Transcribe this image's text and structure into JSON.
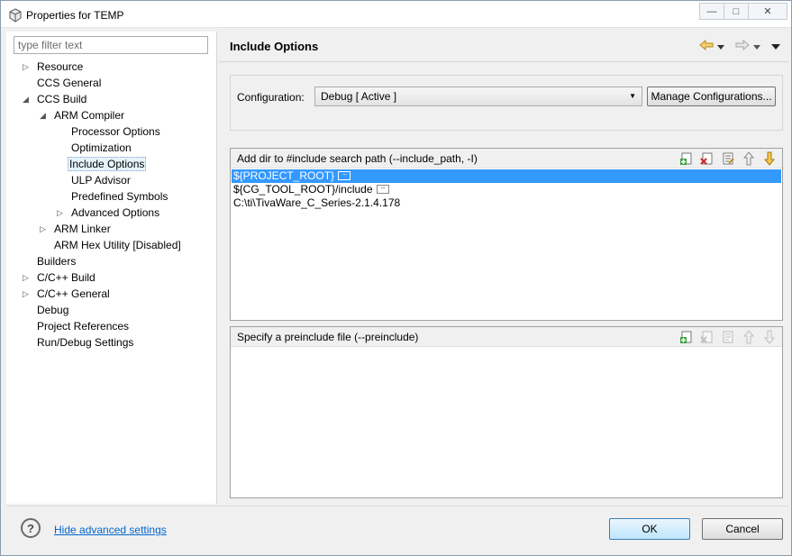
{
  "window": {
    "title": "Properties for TEMP",
    "minimize_glyph": "—",
    "maximize_glyph": "□",
    "close_glyph": "✕"
  },
  "filter": {
    "placeholder": "type filter text"
  },
  "tree": [
    {
      "label": "Resource",
      "expander": "collapsed"
    },
    {
      "label": "CCS General",
      "expander": "none"
    },
    {
      "label": "CCS Build",
      "expander": "expanded"
    },
    {
      "label": "ARM Compiler",
      "expander": "expanded"
    },
    {
      "label": "Processor Options",
      "expander": "none"
    },
    {
      "label": "Optimization",
      "expander": "none"
    },
    {
      "label": "Include Options",
      "expander": "none",
      "selected": true
    },
    {
      "label": "ULP Advisor",
      "expander": "none"
    },
    {
      "label": "Predefined Symbols",
      "expander": "none"
    },
    {
      "label": "Advanced Options",
      "expander": "collapsed"
    },
    {
      "label": "ARM Linker",
      "expander": "collapsed"
    },
    {
      "label": "ARM Hex Utility  [Disabled]",
      "expander": "none"
    },
    {
      "label": "Builders",
      "expander": "none"
    },
    {
      "label": "C/C++ Build",
      "expander": "collapsed"
    },
    {
      "label": "C/C++ General",
      "expander": "collapsed"
    },
    {
      "label": "Debug",
      "expander": "none"
    },
    {
      "label": "Project References",
      "expander": "none"
    },
    {
      "label": "Run/Debug Settings",
      "expander": "none"
    }
  ],
  "page": {
    "title": "Include Options",
    "nav_icons": [
      "back-arrow-icon",
      "dropdown-icon",
      "forward-arrow-icon",
      "dropdown-icon",
      "view-menu-icon"
    ]
  },
  "configuration": {
    "label": "Configuration:",
    "selected": "Debug  [ Active ]",
    "manage_label": "Manage Configurations..."
  },
  "include_paths": {
    "title": "Add dir to #include search path (--include_path, -I)",
    "items": [
      {
        "text": "${PROJECT_ROOT}",
        "selected": true,
        "more": true
      },
      {
        "text": "${CG_TOOL_ROOT}/include",
        "selected": false,
        "more": true
      },
      {
        "text": "C:\\ti\\TivaWare_C_Series-2.1.4.178",
        "selected": false,
        "more": false
      }
    ],
    "tools": [
      "add-icon",
      "delete-icon",
      "edit-icon",
      "move-up-icon",
      "move-down-icon"
    ]
  },
  "preinclude": {
    "title": "Specify a preinclude file (--preinclude)",
    "items": [],
    "tools": [
      "add-icon",
      "delete-icon",
      "edit-icon",
      "move-up-icon",
      "move-down-icon"
    ]
  },
  "footer": {
    "help_glyph": "?",
    "hide_link": "Hide advanced settings",
    "ok_label": "OK",
    "cancel_label": "Cancel"
  },
  "colors": {
    "selection": "#3399ff",
    "link": "#0066cc"
  }
}
